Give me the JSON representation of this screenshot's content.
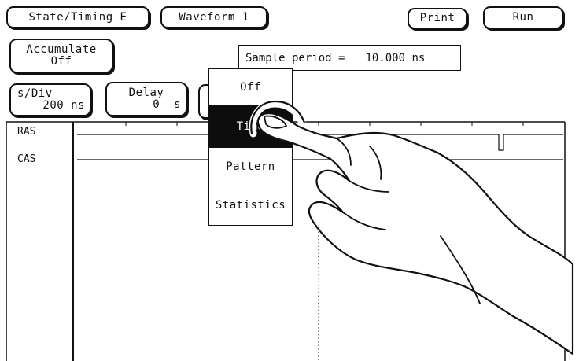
{
  "toolbar": {
    "state_timing": "State/Timing E",
    "waveform": "Waveform 1",
    "print": "Print",
    "run": "Run"
  },
  "accumulate": {
    "label": "Accumulate",
    "value": "Off"
  },
  "sample_period": {
    "label": "Sample period =",
    "value": "10.000 ns"
  },
  "s_div": {
    "label": "s/Div",
    "value": "200 ns"
  },
  "delay": {
    "label": "Delay",
    "value": "0  s"
  },
  "marker_menu": {
    "items": [
      "Off",
      "Time",
      "Pattern",
      "Statistics"
    ],
    "selected_index": 1
  },
  "waveform": {
    "channels": [
      "RAS",
      "CAS"
    ]
  },
  "colors": {
    "ink": "#111111",
    "background": "#ffffff",
    "selected": "#0d0d0d"
  }
}
